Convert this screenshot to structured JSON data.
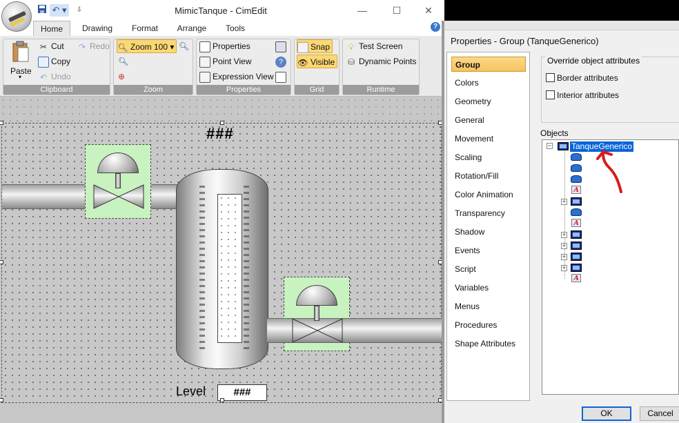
{
  "window": {
    "title": "MimicTanque - CimEdit",
    "minimize_icon": "minimize-icon",
    "maximize_icon": "maximize-icon",
    "close_icon": "close-icon"
  },
  "quick_access": {
    "save_icon": "save-icon",
    "undo_icon": "undo-icon",
    "dropdown_icon": "customize-dropdown-icon"
  },
  "tabs": [
    {
      "label": "Home"
    },
    {
      "label": "Drawing"
    },
    {
      "label": "Format"
    },
    {
      "label": "Arrange"
    },
    {
      "label": "Tools"
    }
  ],
  "ribbon": {
    "clipboard": {
      "label": "Clipboard",
      "paste": "Paste",
      "cut": "Cut",
      "copy": "Copy",
      "redo": "Redo",
      "undo": "Undo"
    },
    "zoom": {
      "label": "Zoom",
      "zoom_value": "Zoom 100"
    },
    "properties": {
      "label": "Properties",
      "properties": "Properties",
      "point_view": "Point View",
      "expression_view": "Expression View"
    },
    "grid": {
      "label": "Grid",
      "snap": "Snap",
      "visible": "Visible"
    },
    "runtime": {
      "label": "Runtime",
      "test_screen": "Test Screen",
      "dynamic_points": "Dynamic Points"
    }
  },
  "canvas": {
    "title_placeholder": "###",
    "level_label": "Level",
    "level_value": "###"
  },
  "properties_panel": {
    "title": "Properties - Group (TanqueGenerico)",
    "categories": [
      "Group",
      "Colors",
      "Geometry",
      "General",
      "Movement",
      "Scaling",
      "Rotation/Fill",
      "Color Animation",
      "Transparency",
      "Shadow",
      "Events",
      "Script",
      "Variables",
      "Menus",
      "Procedures",
      "Shape Attributes"
    ],
    "selected_category": "Group",
    "override_label": "Override object attributes",
    "border_attributes": "Border attributes",
    "interior_attributes": "Interior attributes",
    "objects_label": "Objects",
    "tree_root": "TanqueGenerico",
    "ok": "OK",
    "cancel": "Cancel"
  },
  "annotation_color": "#d91b1b"
}
